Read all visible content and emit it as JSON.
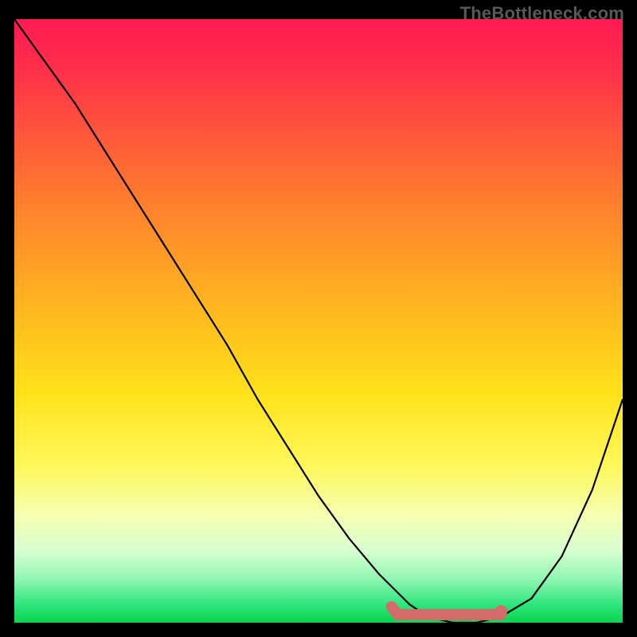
{
  "watermark": "TheBottleneck.com",
  "chart_data": {
    "type": "line",
    "title": "",
    "xlabel": "",
    "ylabel": "",
    "xlim": [
      0,
      100
    ],
    "ylim": [
      0,
      100
    ],
    "series": [
      {
        "name": "curve",
        "x": [
          0,
          5,
          10,
          15,
          20,
          25,
          30,
          35,
          40,
          45,
          50,
          55,
          60,
          65,
          68,
          72,
          76,
          80,
          85,
          90,
          95,
          100
        ],
        "y": [
          100,
          93,
          86,
          78,
          70,
          62,
          54,
          46,
          37,
          29,
          21,
          14,
          8,
          3,
          1,
          0,
          0,
          1,
          4,
          11,
          22,
          37
        ]
      }
    ],
    "highlight": {
      "x_start": 62,
      "x_end": 80,
      "dot_x": 80,
      "dot_y": 1
    },
    "gradient_stops": [
      {
        "pos": 0.0,
        "color": "#ff1a52"
      },
      {
        "pos": 0.5,
        "color": "#ffd21a"
      },
      {
        "pos": 0.82,
        "color": "#f4ffc0"
      },
      {
        "pos": 1.0,
        "color": "#08d44c"
      }
    ]
  }
}
